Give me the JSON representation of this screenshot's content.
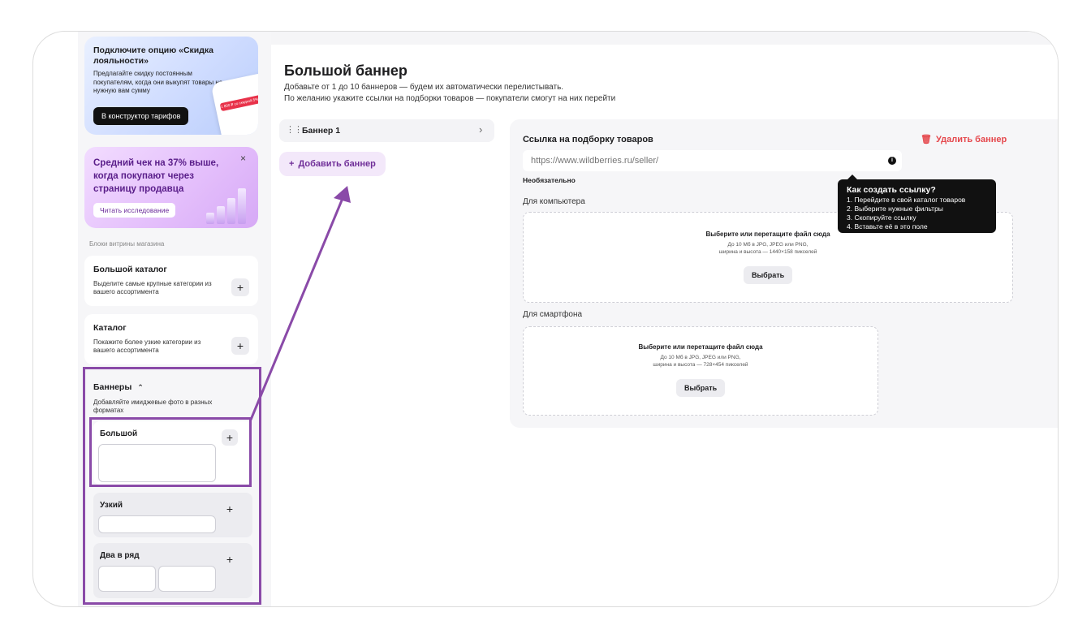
{
  "sidebar": {
    "promo_loyalty": {
      "title": "Подключите опцию «Скидка лояльности»",
      "description": "Предлагайте скидку постоянным покупателям, когда они выкупят товары на нужную вам сумму",
      "button": "В конструктор тарифов",
      "phone_tag": "1 800 ₽ со скидкой 5% +"
    },
    "promo_research": {
      "title": "Средний чек на 37% выше, когда покупают через страницу продавца",
      "button": "Читать исследование",
      "close": "×"
    },
    "section_label": "Блоки витрины магазина",
    "blocks": [
      {
        "title": "Большой каталог",
        "description": "Выделите самые крупные категории из вашего ассортимента"
      },
      {
        "title": "Каталог",
        "description": "Покажите более узкие категории из вашего ассортимента"
      }
    ],
    "banners": {
      "title": "Баннеры",
      "description": "Добавляйте имиджевые фото в разных форматах",
      "items": [
        {
          "title": "Большой"
        },
        {
          "title": "Узкий"
        },
        {
          "title": "Два в ряд"
        }
      ]
    },
    "plus": "+"
  },
  "main": {
    "title": "Большой баннер",
    "subtitle_line1": "Добавьте от 1 до 10 баннеров — будем их автоматически перелистывать.",
    "subtitle_line2": "По желанию укажите ссылки на подборки товаров — покупатели смогут на них перейти",
    "banner_item": "Баннер 1",
    "add_banner": "Добавить баннер",
    "panel": {
      "link_title": "Ссылка на подборку товаров",
      "delete": "Удалить баннер",
      "url_placeholder": "https://www.wildberries.ru/seller/",
      "optional": "Необязательно",
      "desktop_label": "Для компьютера",
      "mobile_label": "Для смартфона",
      "drop_heading": "Выберите или перетащите файл сюда",
      "drop_formats": "До 10 Мб в JPG, JPEG или PNG,",
      "desktop_size": "ширина и высота — 1440×158 пикселей",
      "mobile_size": "ширина и высота — 728×454 пикселей",
      "choose": "Выбрать"
    },
    "tooltip": {
      "heading": "Как создать ссылку?",
      "steps": [
        "1. Перейдите в свой каталог товаров",
        "2. Выберите нужные фильтры",
        "3. Скопируйте ссылку",
        "4. Вставьте её в это поле"
      ]
    }
  },
  "colors": {
    "accent": "#8a4aa8",
    "danger": "#e5484d",
    "brand_purple": "#6f2e98"
  }
}
